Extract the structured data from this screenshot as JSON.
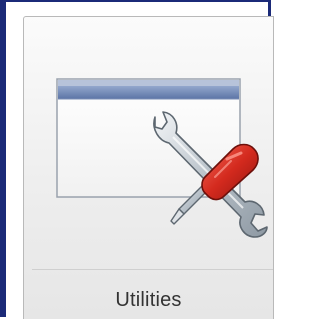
{
  "tile": {
    "label": "Utilities",
    "icon": "utilities-icon"
  },
  "colors": {
    "frame_border": "#1b2a78",
    "window_titlebar": "#6d82ad",
    "screwdriver_handle": "#d42a1e",
    "wrench": "#c8cfd6"
  }
}
